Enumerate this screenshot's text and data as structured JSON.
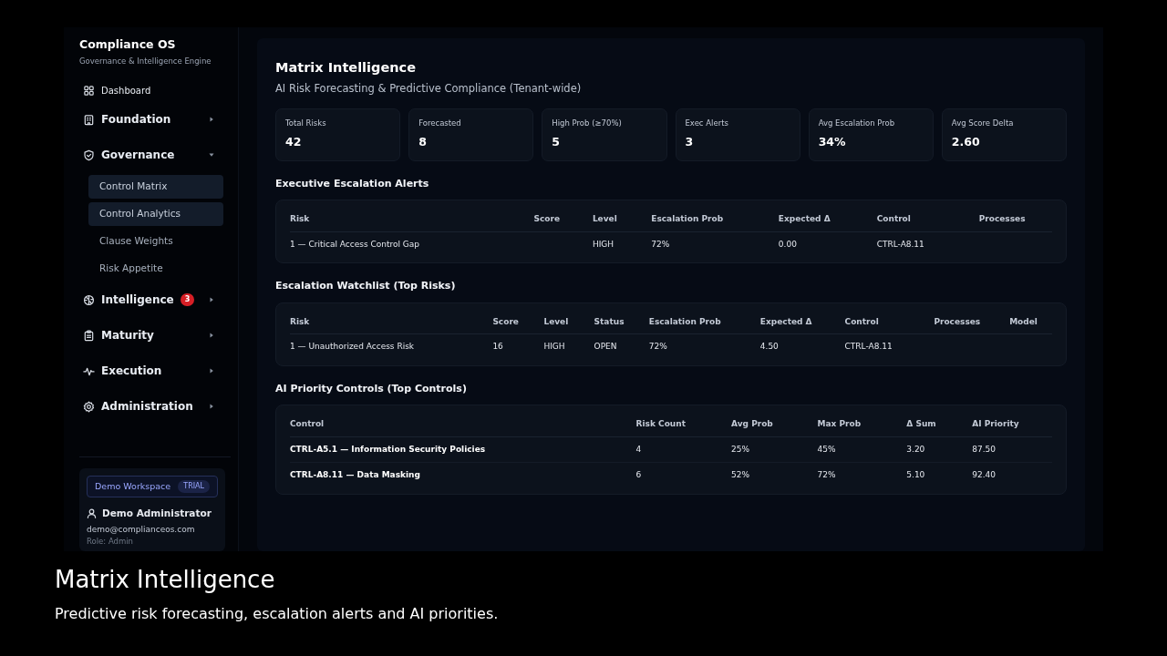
{
  "brand": {
    "title": "Compliance OS",
    "subtitle": "Governance & Intelligence Engine"
  },
  "nav": [
    {
      "label": "Dashboard",
      "kind": "link"
    },
    {
      "label": "Foundation",
      "kind": "group",
      "expanded": false
    },
    {
      "label": "Governance",
      "kind": "group",
      "expanded": true,
      "children": [
        {
          "label": "Control Matrix",
          "selected": true
        },
        {
          "label": "Control Analytics",
          "selected": true
        },
        {
          "label": "Clause Weights",
          "selected": false
        },
        {
          "label": "Risk Appetite",
          "selected": false
        }
      ]
    },
    {
      "label": "Intelligence",
      "kind": "group",
      "expanded": false,
      "badge": "3"
    },
    {
      "label": "Maturity",
      "kind": "group",
      "expanded": false
    },
    {
      "label": "Execution",
      "kind": "group",
      "expanded": false
    },
    {
      "label": "Administration",
      "kind": "group",
      "expanded": false
    }
  ],
  "account": {
    "workspace": "Demo Workspace",
    "plan": "TRIAL",
    "user": "Demo Administrator",
    "email": "demo@complianceos.com",
    "role": "Role: Admin"
  },
  "page": {
    "title": "Matrix Intelligence",
    "subtitle": "AI Risk Forecasting & Predictive Compliance (Tenant-wide)"
  },
  "stats": [
    {
      "label": "Total Risks",
      "value": "42"
    },
    {
      "label": "Forecasted",
      "value": "8"
    },
    {
      "label": "High Prob (≥70%)",
      "value": "5"
    },
    {
      "label": "Exec Alerts",
      "value": "3"
    },
    {
      "label": "Avg Escalation Prob",
      "value": "34%"
    },
    {
      "label": "Avg Score Delta",
      "value": "2.60"
    }
  ],
  "tables": [
    {
      "title": "Executive Escalation Alerts",
      "kind": "risks",
      "columns": [
        "Risk",
        "Score",
        "Level",
        "Escalation Prob",
        "Expected Δ",
        "Control",
        "Processes"
      ],
      "rows": [
        [
          "1 — Critical Access Control Gap",
          null,
          "HIGH",
          "72%",
          "0.00",
          "CTRL-A8.11",
          null
        ]
      ]
    },
    {
      "title": "Escalation Watchlist (Top Risks)",
      "kind": "risks",
      "columns": [
        "Risk",
        "Score",
        "Level",
        "Status",
        "Escalation Prob",
        "Expected Δ",
        "Control",
        "Processes",
        "Model"
      ],
      "rows": [
        [
          "1 — Unauthorized Access Risk",
          "16",
          "HIGH",
          "OPEN",
          "72%",
          "4.50",
          "CTRL-A8.11",
          null,
          null
        ]
      ]
    },
    {
      "title": "AI Priority Controls (Top Controls)",
      "kind": "controls",
      "columns": [
        "Control",
        "Risk Count",
        "Avg Prob",
        "Max Prob",
        "Δ Sum",
        "AI Priority"
      ],
      "rows": [
        [
          "CTRL-A5.1 — Information Security Policies",
          "4",
          "25%",
          "45%",
          "3.20",
          "87.50"
        ],
        [
          "CTRL-A8.11 — Data Masking",
          "6",
          "52%",
          "72%",
          "5.10",
          "92.40"
        ]
      ]
    }
  ],
  "caption": {
    "title": "Matrix Intelligence",
    "text": "Predictive risk forecasting, escalation alerts and AI priorities."
  }
}
